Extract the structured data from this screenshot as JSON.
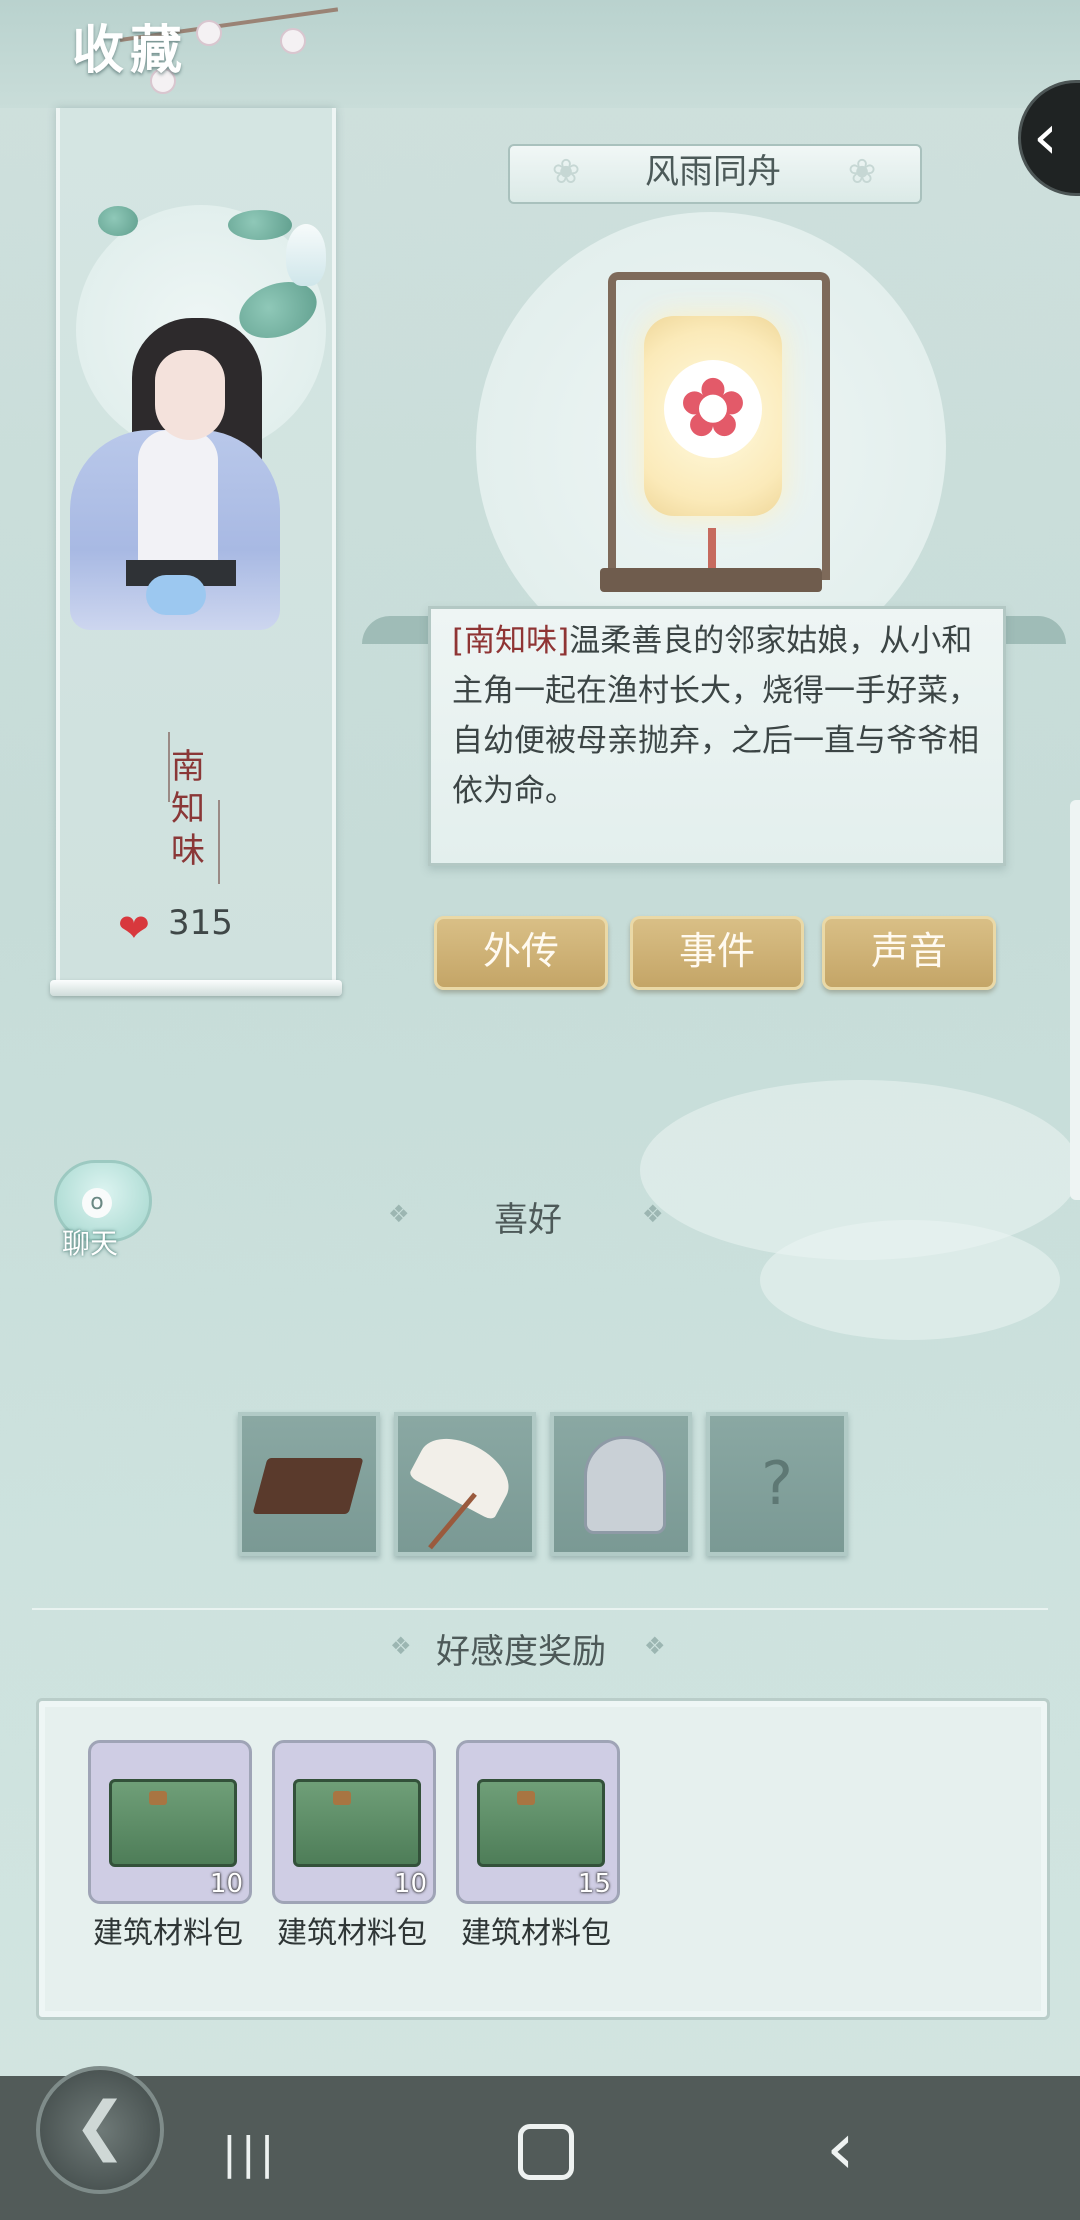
{
  "header": {
    "title": "收藏"
  },
  "hero": {
    "banner_title": "风雨同舟"
  },
  "character": {
    "name": "南知味",
    "name_chars": [
      "南",
      "知",
      "味"
    ],
    "affection": "315"
  },
  "description": {
    "name_tag": "[南知味]",
    "text": "温柔善良的邻家姑娘，从小和主角一起在渔村长大，烧得一手好菜，自幼便被母亲抛弃，之后一直与爷爷相依为命。"
  },
  "buttons": {
    "biography": "外传",
    "events": "事件",
    "voice": "声音"
  },
  "chat": {
    "label": "聊天"
  },
  "preferences": {
    "title": "喜好",
    "items": [
      {
        "icon": "brown-sheets-item-icon"
      },
      {
        "icon": "paper-umbrella-item-icon"
      },
      {
        "icon": "crane-statue-item-icon"
      },
      {
        "icon": "unknown-item-icon",
        "label": "?"
      }
    ]
  },
  "rewards": {
    "title": "好感度奖励",
    "items": [
      {
        "name": "建筑材料包",
        "count": "10"
      },
      {
        "name": "建筑材料包",
        "count": "10"
      },
      {
        "name": "建筑材料包",
        "count": "15"
      }
    ]
  },
  "nav": {
    "recent": "|||",
    "back_glyph": "‹",
    "game_back_glyph": "❮"
  },
  "colors": {
    "accent_gold": "#c4a567",
    "name_red": "#8f3434",
    "heart": "#d8383d",
    "navbar": "#525b59"
  }
}
